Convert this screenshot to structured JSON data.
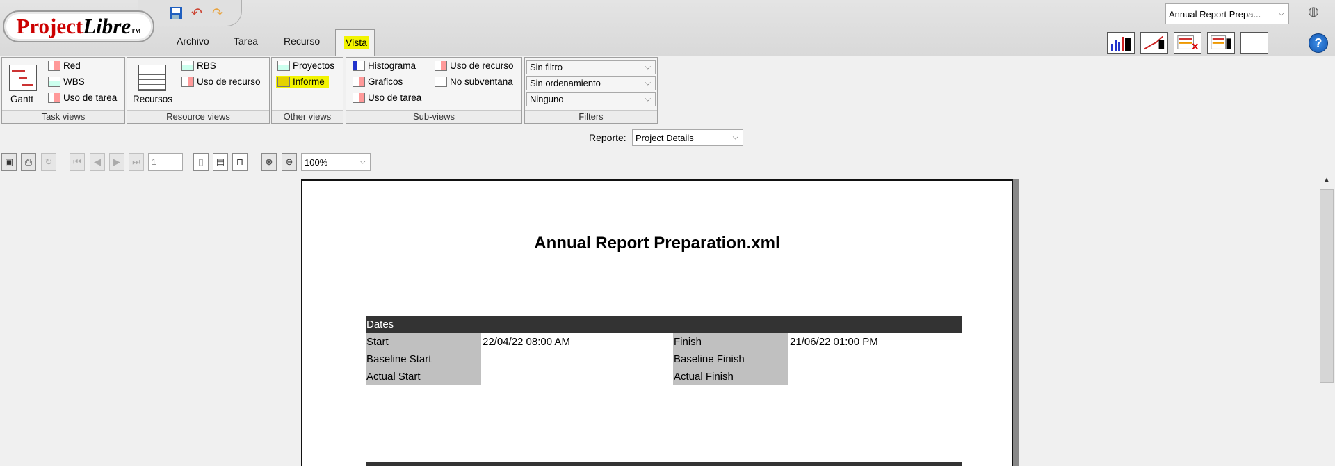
{
  "app": {
    "logo_main": "Project",
    "logo_italic": "Libre",
    "logo_tm": "TM",
    "project_selector": "Annual Report Prepa...",
    "help_label": "?"
  },
  "quick_access": [
    "save-icon",
    "undo-icon",
    "redo-icon"
  ],
  "menu": {
    "archivo": "Archivo",
    "tarea": "Tarea",
    "recurso": "Recurso",
    "vista": "Vista"
  },
  "ribbon": {
    "task_views": {
      "caption": "Task views",
      "gantt": "Gantt",
      "red": "Red",
      "wbs": "WBS",
      "uso_de_tarea": "Uso de tarea"
    },
    "resource_views": {
      "caption": "Resource views",
      "recursos": "Recursos",
      "rbs": "RBS",
      "uso_de_recurso": "Uso de recurso"
    },
    "other_views": {
      "caption": "Other views",
      "proyectos": "Proyectos",
      "informe": "Informe"
    },
    "sub_views": {
      "caption": "Sub-views",
      "histograma": "Histograma",
      "graficos": "Graficos",
      "uso_de_tarea": "Uso de tarea",
      "uso_de_recurso": "Uso de recurso",
      "no_subventana": "No subventana"
    },
    "filters": {
      "caption": "Filters",
      "filter": "Sin filtro",
      "sort": "Sin ordenamiento",
      "group": "Ninguno"
    }
  },
  "report_bar": {
    "label": "Reporte:",
    "selected": "Project Details"
  },
  "viewer_toolbar": {
    "page_number": "1",
    "zoom": "100%"
  },
  "report": {
    "title": "Annual Report Preparation.xml",
    "section_dates": "Dates",
    "start_label": "Start",
    "start_value": "22/04/22 08:00 AM",
    "baseline_start_label": "Baseline Start",
    "actual_start_label": "Actual Start",
    "finish_label": "Finish",
    "finish_value": "21/06/22 01:00 PM",
    "baseline_finish_label": "Baseline Finish",
    "actual_finish_label": "Actual Finish"
  },
  "colors": {
    "highlight": "#f2f400",
    "section_header": "#333333",
    "label_bg": "#c0c0c0",
    "logo_red": "#cc0000"
  }
}
